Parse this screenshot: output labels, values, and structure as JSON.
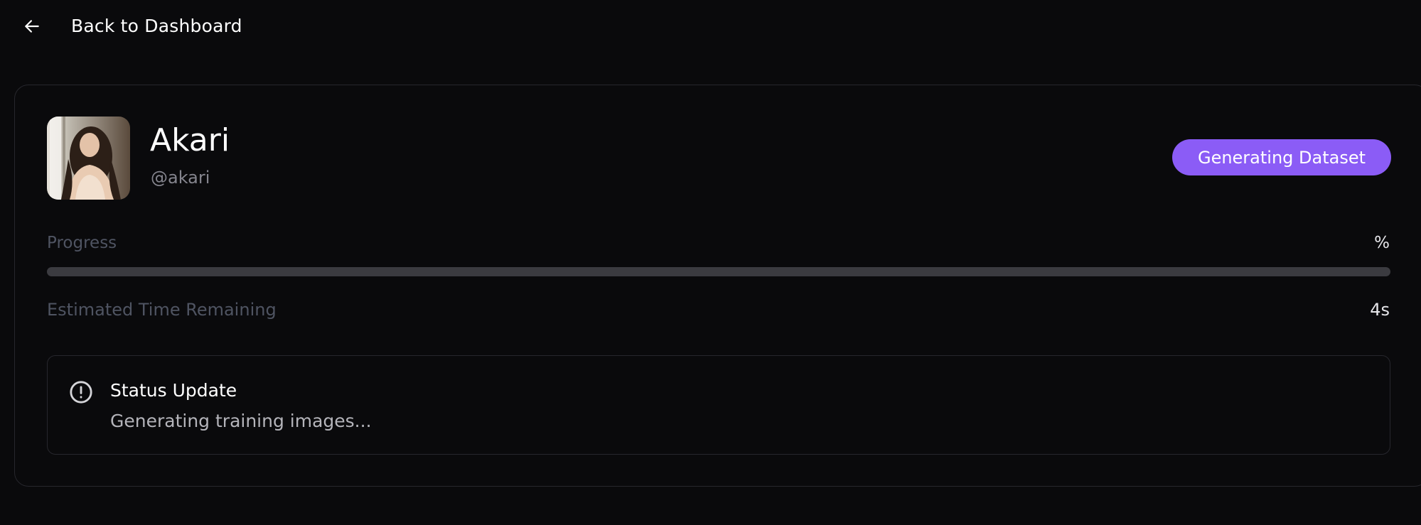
{
  "nav": {
    "back_label": "Back to Dashboard",
    "back_icon": "arrow-left-icon"
  },
  "profile": {
    "name": "Akari",
    "handle": "@akari",
    "status": "Generating Dataset",
    "accent_color": "#8b5cf6"
  },
  "progress": {
    "label": "Progress",
    "value_text": "%",
    "fraction": 0
  },
  "eta": {
    "label": "Estimated Time Remaining",
    "value": "4s"
  },
  "status_update": {
    "icon": "alert-circle-icon",
    "title": "Status Update",
    "message": "Generating training images..."
  }
}
